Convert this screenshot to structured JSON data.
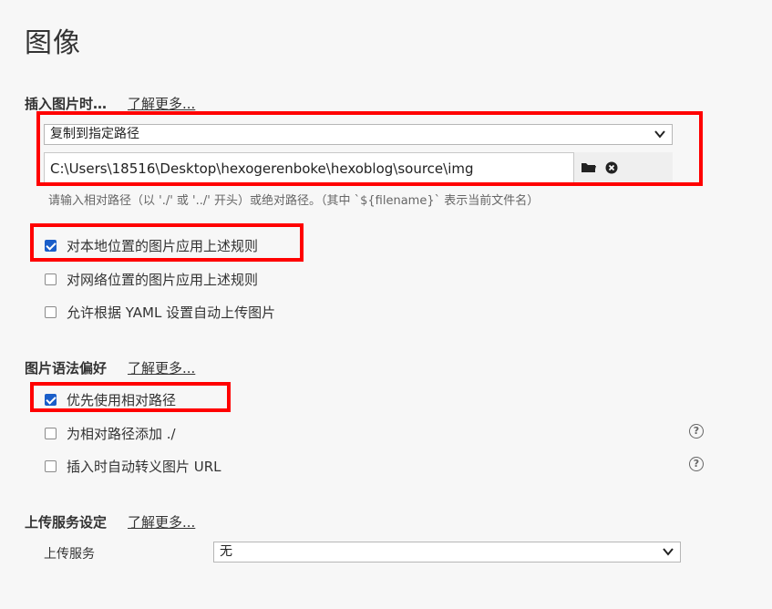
{
  "page": {
    "title": "图像"
  },
  "insert_section": {
    "title": "插入图片时…",
    "learn_more": "了解更多...",
    "action_select": "复制到指定路径",
    "path_value": "C:\\Users\\18516\\Desktop\\hexogerenboke\\hexoblog\\source\\img",
    "hint": "请输入相对路径（以 './' 或 '../' 开头）或绝对路径。（其中 `${filename}` 表示当前文件名）",
    "checkboxes": [
      {
        "label": "对本地位置的图片应用上述规则",
        "checked": true
      },
      {
        "label": "对网络位置的图片应用上述规则",
        "checked": false
      },
      {
        "label": "允许根据 YAML 设置自动上传图片",
        "checked": false
      }
    ]
  },
  "syntax_section": {
    "title": "图片语法偏好",
    "learn_more": "了解更多...",
    "checkboxes": [
      {
        "label": "优先使用相对路径",
        "checked": true
      },
      {
        "label": "为相对路径添加 ./",
        "checked": false
      },
      {
        "label": "插入时自动转义图片 URL",
        "checked": false
      }
    ],
    "help_glyph": "?"
  },
  "upload_section": {
    "title": "上传服务设定",
    "learn_more": "了解更多...",
    "service_label": "上传服务",
    "service_value": "无"
  },
  "icons": {
    "folder": "folder-icon",
    "clear": "clear-circle-icon",
    "chevron": "chevron-down-icon",
    "help": "help-circle-icon"
  },
  "colors": {
    "accent_checkbox": "#1a5ec9",
    "highlight_box": "#ff0000",
    "background": "#f7f7f7"
  }
}
